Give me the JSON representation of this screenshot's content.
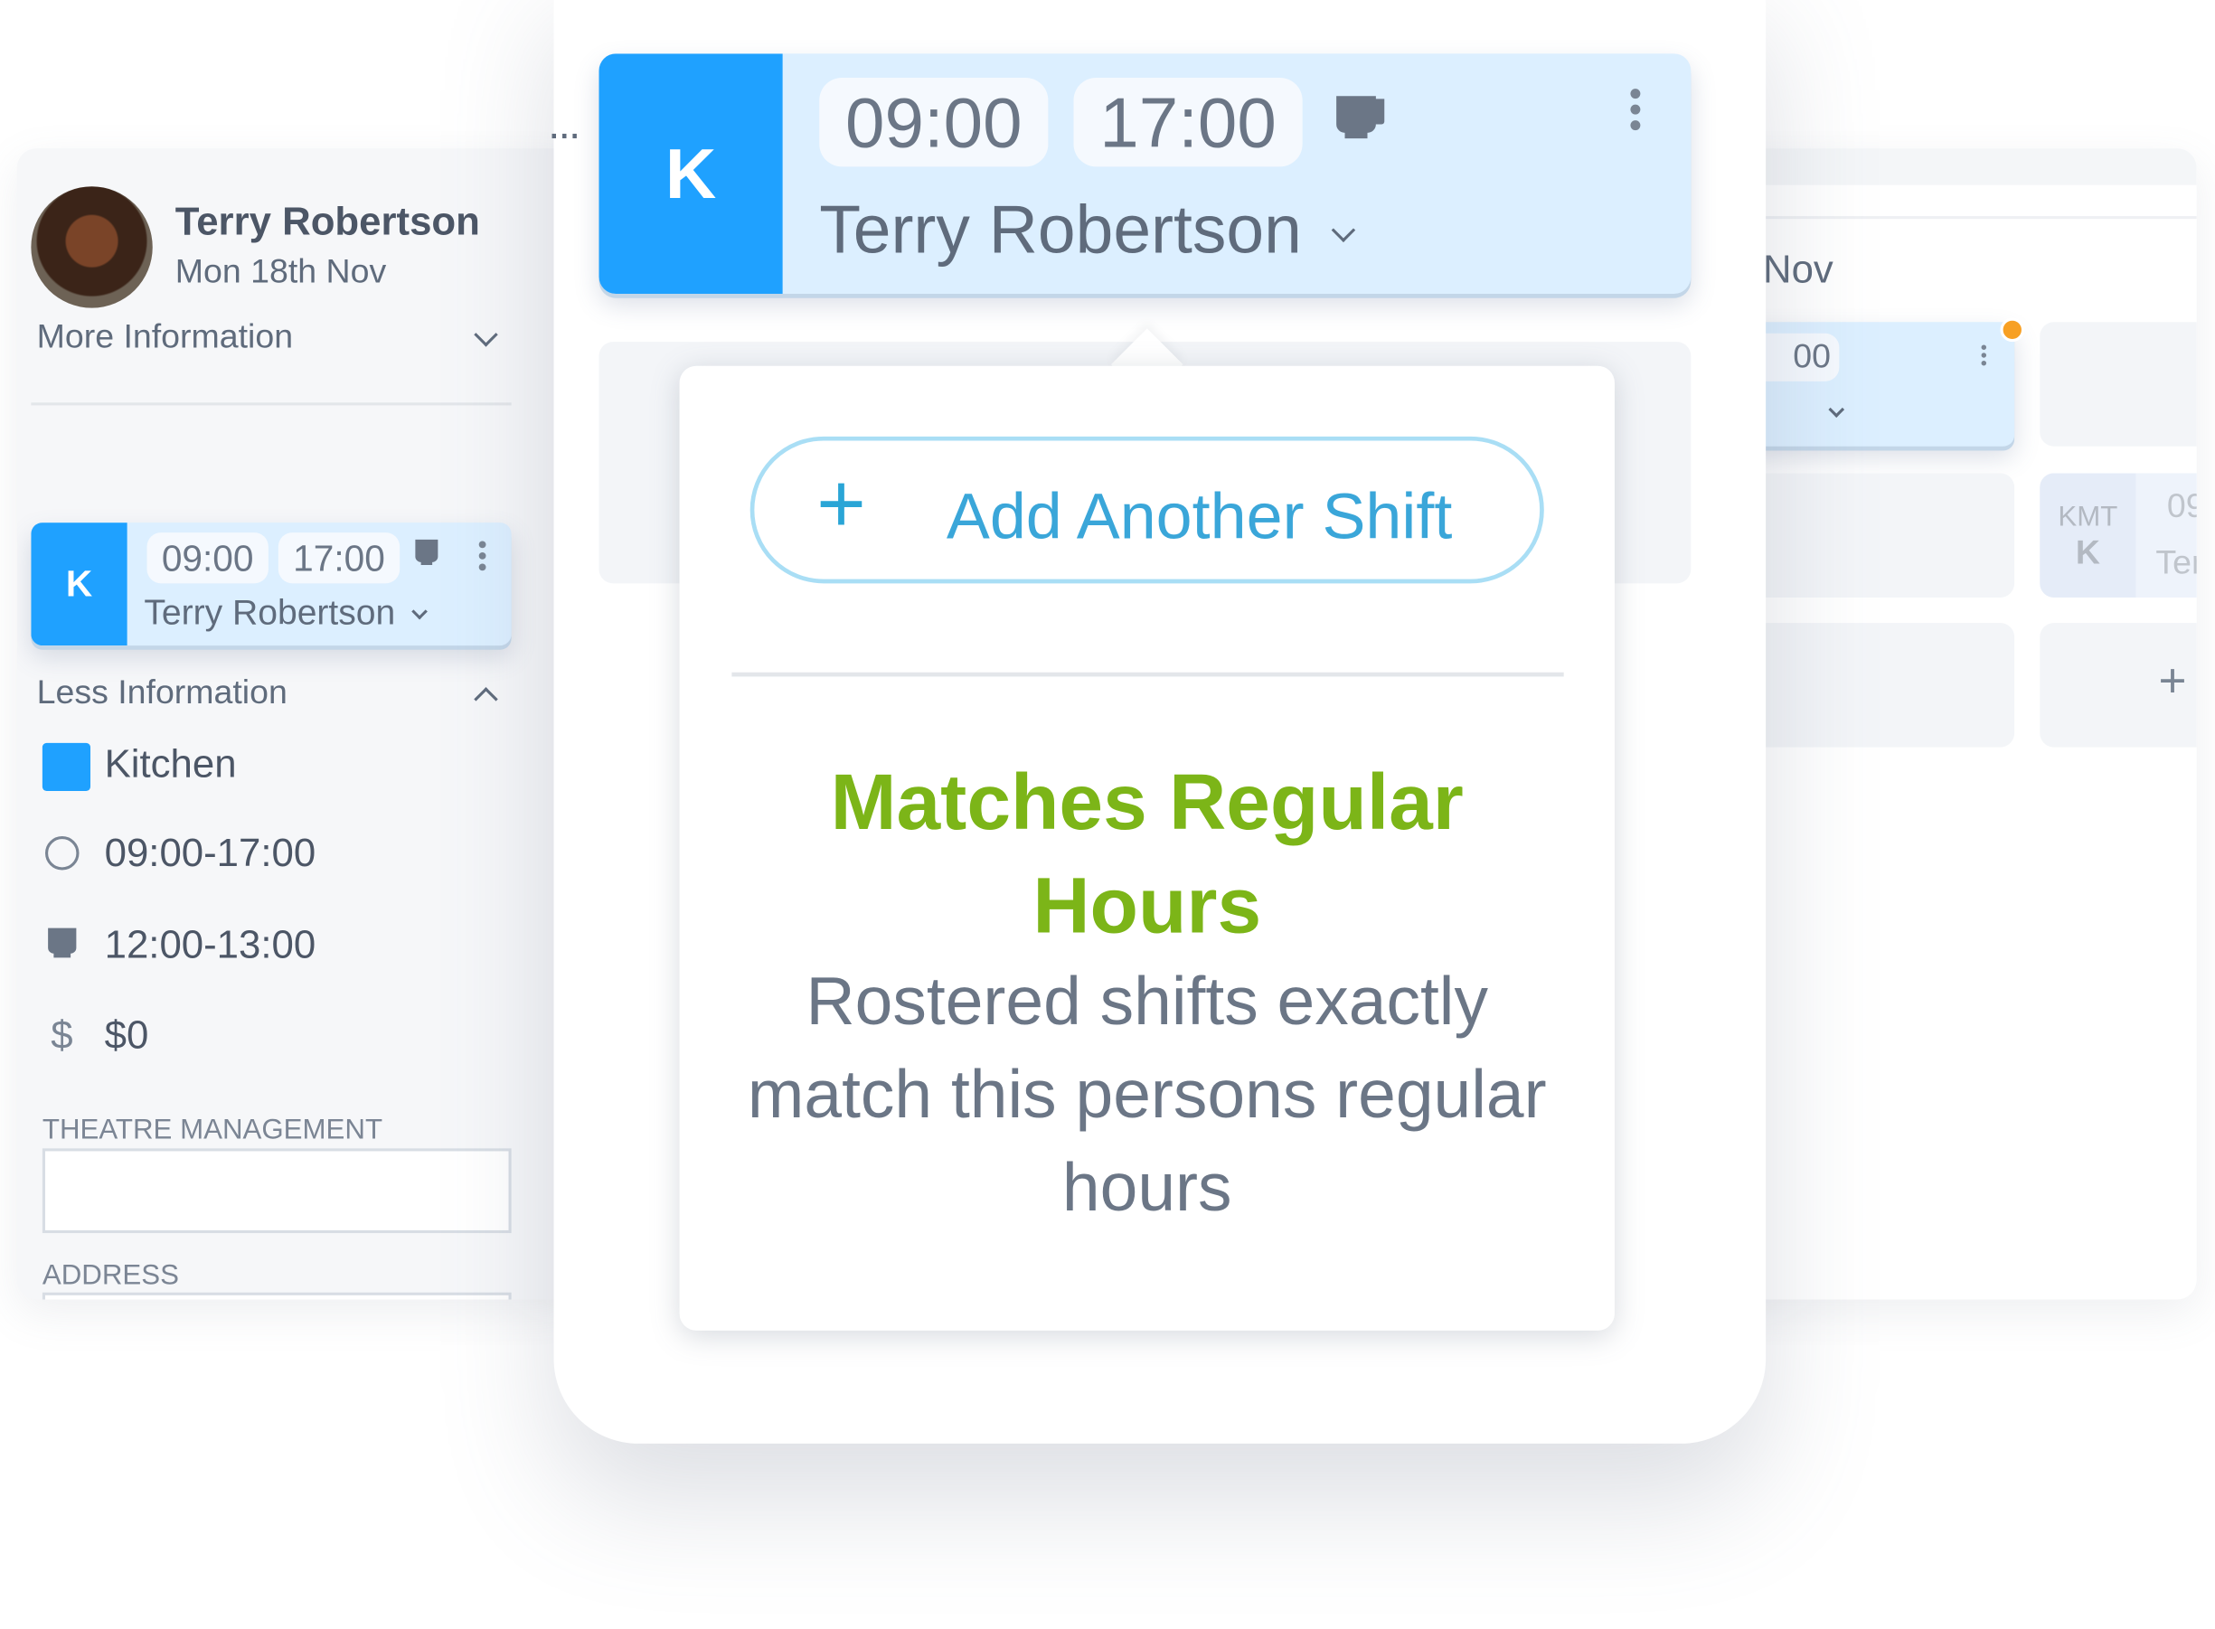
{
  "left_panel": {
    "employee_name": "Terry Robertson",
    "date": "Mon 18th Nov",
    "more_info_label": "More Information",
    "shift": {
      "role_initial": "K",
      "start": "09:00",
      "end": "17:00",
      "employee": "Terry Robertson"
    },
    "less_info_label": "Less Information",
    "department": "Kitchen",
    "department_color": "#1fa1ff",
    "shift_hours": "09:00-17:00",
    "break_hours": "12:00-13:00",
    "cost": "$0",
    "theatre_management_label": "THEATRE MANAGEMENT",
    "theatre_management_value": "",
    "address_label": "ADDRESS"
  },
  "center": {
    "more_dots": "...",
    "shift": {
      "role_initial": "K",
      "start": "09:00",
      "end": "17:00",
      "employee": "Terry Robertson"
    },
    "popover": {
      "add_button_label": "Add Another Shift",
      "plus": "+",
      "status_title": "Matches Regular Hours",
      "status_color": "#7cb518",
      "status_description": "Rostered shifts exactly match this persons regular hours"
    }
  },
  "right_panel": {
    "month": "Nov",
    "shift_time_partial": "00",
    "kmt_label": "KMT",
    "kmt_initial": "K",
    "partial_time": "09",
    "partial_name": "Ter",
    "plus": "+",
    "alert_color": "#f7a024"
  },
  "colors": {
    "accent": "#1fa1ff",
    "shift_bg": "#dcefff",
    "add_button_text": "#3aa6d9"
  }
}
